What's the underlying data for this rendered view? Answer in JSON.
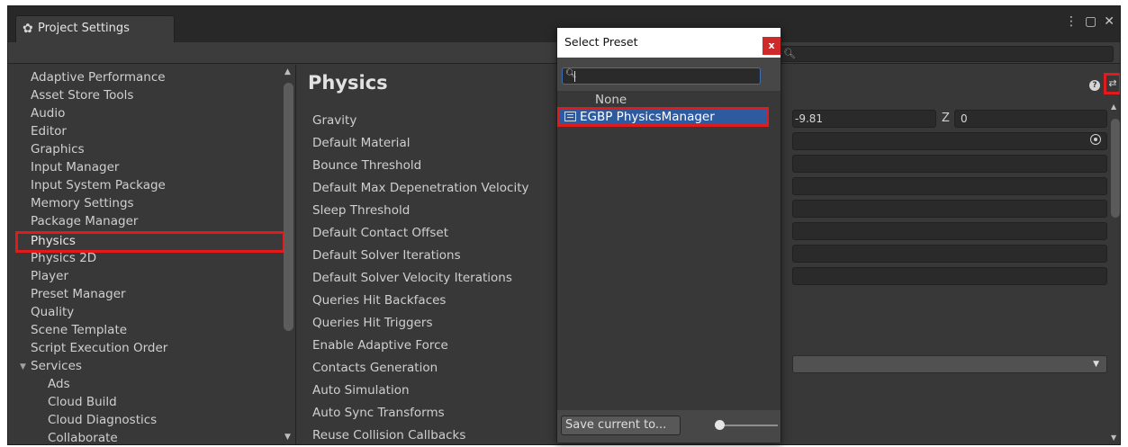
{
  "window": {
    "tab_title": "Project Settings",
    "controls": [
      "⋮",
      "▢",
      "✕"
    ]
  },
  "search": {
    "placeholder": ""
  },
  "sidebar": {
    "items": [
      "Adaptive Performance",
      "Asset Store Tools",
      "Audio",
      "Editor",
      "Graphics",
      "Input Manager",
      "Input System Package",
      "Memory Settings",
      "Package Manager",
      "Physics",
      "Physics 2D",
      "Player",
      "Preset Manager",
      "Quality",
      "Scene Template",
      "Script Execution Order",
      "Services",
      "Ads",
      "Cloud Build",
      "Cloud Diagnostics",
      "Collaborate"
    ],
    "selected": "Physics"
  },
  "main": {
    "title": "Physics",
    "properties": [
      "Gravity",
      "Default Material",
      "Bounce Threshold",
      "Default Max Depenetration Velocity",
      "Sleep Threshold",
      "Default Contact Offset",
      "Default Solver Iterations",
      "Default Solver Velocity Iterations",
      "Queries Hit Backfaces",
      "Queries Hit Triggers",
      "Enable Adaptive Force",
      "Contacts Generation",
      "Auto Simulation",
      "Auto Sync Transforms",
      "Reuse Collision Callbacks"
    ],
    "gravity_y": "-9.81",
    "gravity_z_label": "Z",
    "gravity_z": "0"
  },
  "popup": {
    "title": "Select Preset",
    "close_label": "x",
    "search_value": "",
    "items": [
      "None",
      "EGBP PhysicsManager"
    ],
    "selected": "EGBP PhysicsManager",
    "save_label": "Save current to..."
  },
  "colors": {
    "highlight_red": "#e11b1b",
    "selection_blue": "#2e5aa0",
    "panel_bg": "#383838"
  }
}
